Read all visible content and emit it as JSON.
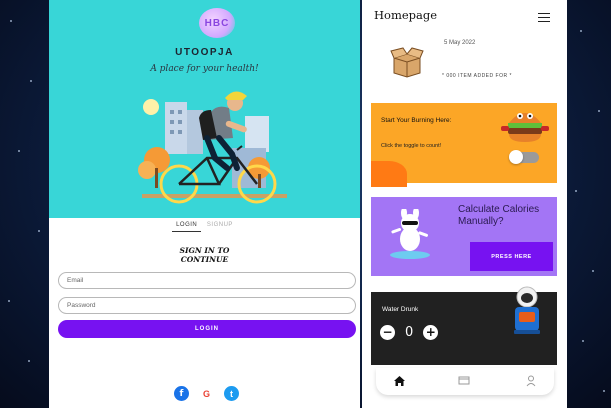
{
  "login_screen": {
    "logo_text": "HBC",
    "app_name": "UTOOPJA",
    "tagline": "A place for your health!",
    "tabs": [
      {
        "label": "LOGIN",
        "active": true
      },
      {
        "label": "SIGNUP",
        "active": false
      }
    ],
    "sign_in_title_line1": "SIGN IN TO",
    "sign_in_title_line2": "CONTINUE",
    "email_placeholder": "Email",
    "password_placeholder": "Password",
    "login_button": "LOGIN",
    "social_logins": [
      {
        "name": "facebook-icon",
        "glyph": "f",
        "color": "#1a73e8"
      },
      {
        "name": "google-icon",
        "glyph": "G",
        "color": "#ea4335"
      },
      {
        "name": "twitter-icon",
        "glyph": "t",
        "color": "#1d9bf0"
      }
    ]
  },
  "home_screen": {
    "title": "Homepage",
    "date_text": "5 May 2022",
    "empty_caption": "* 000 ITEM ADDED FOR *",
    "burn_card": {
      "title": "Start Your Burning Here:",
      "subtitle": "Click the toggle to count!",
      "toggle_on": false
    },
    "calc_card": {
      "title_line1": "Calculate Calories",
      "title_line2": "Manually?",
      "button": "PRESS HERE"
    },
    "water_card": {
      "title": "Water Drunk",
      "count": "0",
      "minus": "−",
      "plus": "+"
    },
    "bottom_nav": [
      "home-icon",
      "card-icon",
      "profile-icon"
    ]
  },
  "colors": {
    "hero": "#38d6d7",
    "primary": "#7712f1",
    "burn_card": "#fca626",
    "calc_card": "#a375f5",
    "water_card": "#212121"
  }
}
